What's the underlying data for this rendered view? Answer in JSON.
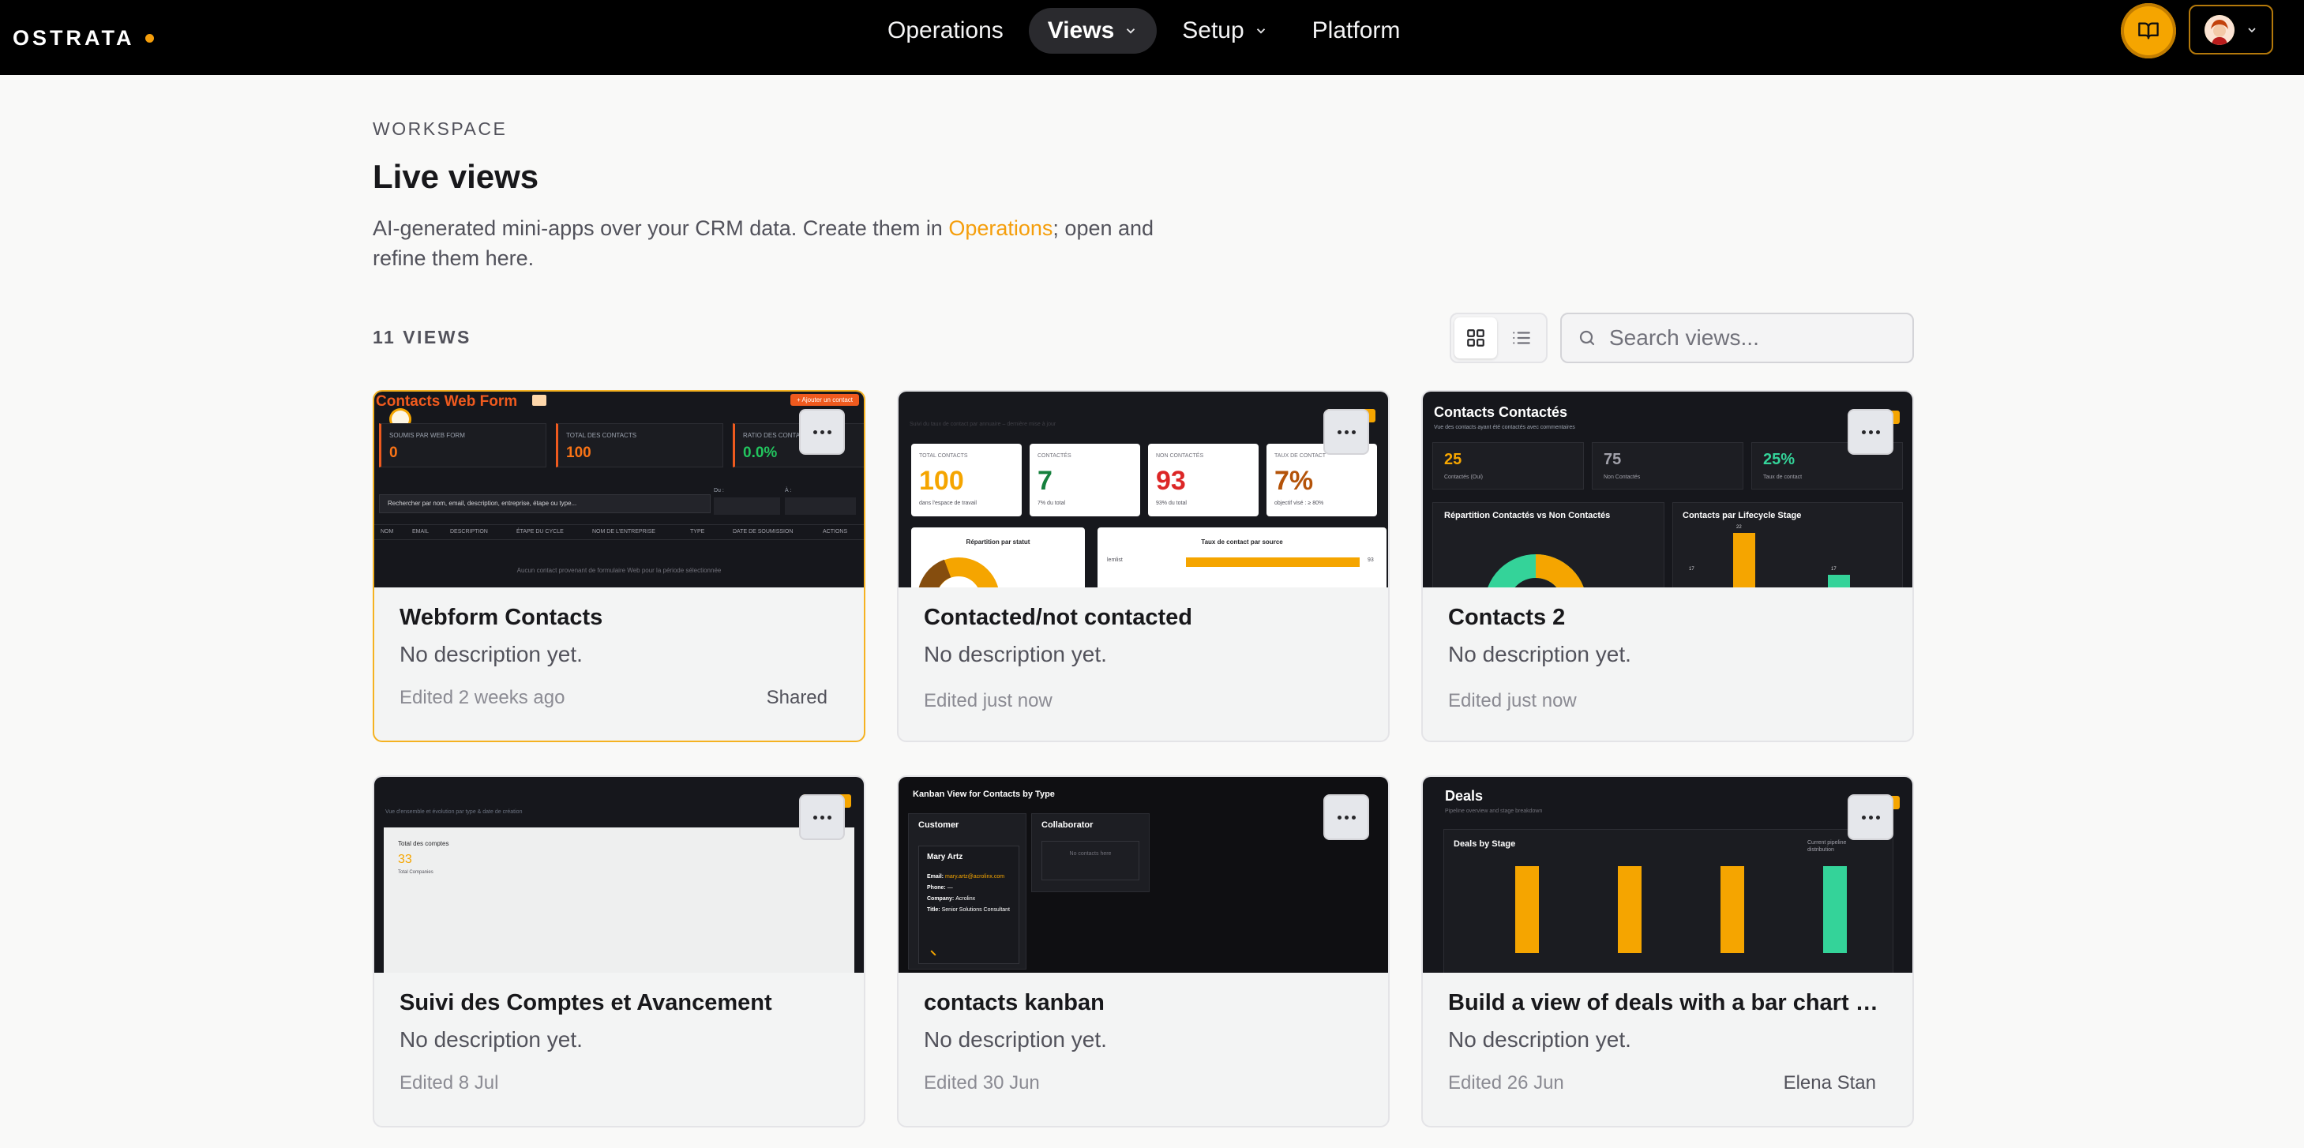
{
  "brand": {
    "logo": "OSTRATA",
    "accent": "#f59e0b"
  },
  "nav": {
    "items": [
      {
        "label": "Operations",
        "active": false,
        "dropdown": false
      },
      {
        "label": "Views",
        "active": true,
        "dropdown": true
      },
      {
        "label": "Setup",
        "active": false,
        "dropdown": true
      },
      {
        "label": "Platform",
        "active": false,
        "dropdown": false
      }
    ],
    "docs_icon": "book-open-icon",
    "user_icon": "avatar"
  },
  "header": {
    "eyebrow": "WORKSPACE",
    "title": "Live views",
    "desc_before": "AI-generated mini-apps over your CRM data. Create them in ",
    "desc_link": "Operations",
    "desc_after": "; open and refine them here."
  },
  "toolbar": {
    "count": "11 VIEWS",
    "view_mode": "grid",
    "search_placeholder": "Search views..."
  },
  "cards": [
    {
      "title": "Webform Contacts",
      "desc": "No description yet.",
      "meta": "Edited 2 weeks ago",
      "tag": "Shared",
      "selected": true
    },
    {
      "title": "Contacted/not contacted",
      "desc": "No description yet.",
      "meta": "Edited just now",
      "tag": ""
    },
    {
      "title": "Contacts 2",
      "desc": "No description yet.",
      "meta": "Edited just now",
      "tag": ""
    },
    {
      "title": "Suivi des Comptes et Avancement",
      "desc": "No description yet.",
      "meta": "Edited 8 Jul",
      "tag": ""
    },
    {
      "title": "contacts kanban",
      "desc": "No description yet.",
      "meta": "Edited 30 Jun",
      "tag": ""
    },
    {
      "title": "Build a view of deals with a bar chart by…",
      "desc": "No description yet.",
      "meta": "Edited 26 Jun",
      "tag": "Elena Stan"
    }
  ],
  "previews": {
    "webform": {
      "title": "Contacts Web Form",
      "add_btn": "+ Ajouter un contact",
      "stats": [
        {
          "label": "SOUMIS PAR WEB FORM",
          "value": "0"
        },
        {
          "label": "TOTAL DES CONTACTS",
          "value": "100"
        },
        {
          "label": "RATIO DES CONTACTS WEB",
          "value": "0.0%"
        }
      ],
      "search_ph": "Rechercher par nom, email, description, entreprise, étape ou type...",
      "from_label": "Du :",
      "to_label": "À :",
      "columns": [
        "NOM",
        "EMAIL",
        "DESCRIPTION",
        "ÉTAPE DU CYCLE",
        "NOM DE L'ENTREPRISE",
        "TYPE",
        "DATE DE SOUMISSION",
        "ACTIONS"
      ],
      "empty": "Aucun contact provenant de formulaire Web pour la période sélectionnée"
    },
    "contacted": {
      "subtitle": "Suivi du taux de contact par annuaire – dernière mise à jour",
      "btn": "+ Nouveau",
      "stats": [
        {
          "label": "TOTAL CONTACTS",
          "value": "100",
          "sub": "dans l'espace de travail",
          "color": "#f5a500"
        },
        {
          "label": "CONTACTÉS",
          "value": "7",
          "sub": "7% du total",
          "color": "#15803d"
        },
        {
          "label": "NON CONTACTÉS",
          "value": "93",
          "sub": "93% du total",
          "color": "#dc2626"
        },
        {
          "label": "TAUX DE CONTACT",
          "value": "7%",
          "sub": "objectif visé : ≥ 80%",
          "color": "#b45309"
        }
      ],
      "panel1": "Répartition par statut",
      "panel2": "Taux de contact par source",
      "bar_label": "lemlist",
      "bar_value": "93"
    },
    "contacts2": {
      "title": "Contacts Contactés",
      "subtitle": "Vue des contacts ayant été contactés avec commentaires",
      "btn": "+ Nouveau",
      "stats": [
        {
          "value": "25",
          "label": "Contactés (Oui)",
          "color": "#f5a500"
        },
        {
          "value": "75",
          "label": "Non Contactés",
          "color": "#a1a1aa"
        },
        {
          "value": "25%",
          "label": "Taux de contact",
          "color": "#34d399"
        }
      ],
      "panel1": "Répartition Contactés vs Non Contactés",
      "panel2": "Contacts par Lifecycle Stage",
      "bars": [
        {
          "label": "17",
          "value": 17,
          "color": "#f5a500"
        },
        {
          "label": "22",
          "value": 70,
          "color": "#f5a500"
        },
        {
          "label": "17",
          "value": 17,
          "color": "#34d399"
        }
      ]
    },
    "suivi": {
      "subtitle": "Vue d'ensemble et évolution par type & date de création",
      "btn": "+ Nouveau",
      "stat_label": "Total des comptes",
      "stat_value": "33",
      "stat_sub": "Total Companies"
    },
    "kanban": {
      "title": "Kanban View for Contacts by Type",
      "columns": [
        "Customer",
        "Collaborator"
      ],
      "card_name": "Mary Artz",
      "fields": [
        {
          "k": "Email:",
          "v": "mary.artz@acrolinx.com"
        },
        {
          "k": "Phone:",
          "v": "—"
        },
        {
          "k": "Company:",
          "v": "Acrolinx"
        },
        {
          "k": "Title:",
          "v": "Senior Solutions Consultant"
        }
      ],
      "empty": "No contacts here"
    },
    "deals": {
      "title": "Deals",
      "subtitle": "Pipeline overview and stage breakdown",
      "btn": "+ New",
      "chart_title": "Deals by Stage",
      "legend": "Current pipeline distribution",
      "chart_data": {
        "type": "bar",
        "categories": [
          "",
          "",
          "",
          ""
        ],
        "values": [
          1,
          1,
          1,
          1
        ],
        "ylim": [
          0,
          1
        ]
      },
      "bar_colors": [
        "#f5a500",
        "#f5a500",
        "#f5a500",
        "#34d399"
      ]
    }
  }
}
